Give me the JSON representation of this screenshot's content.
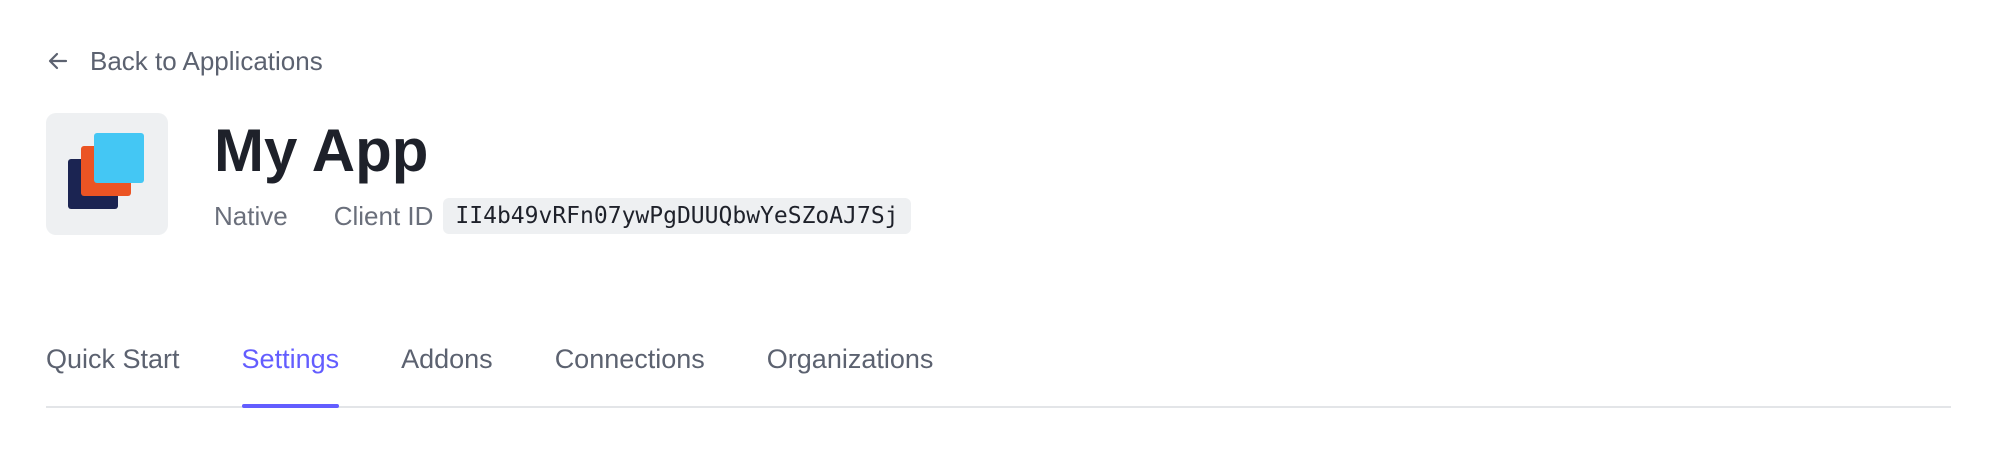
{
  "back_link": {
    "label": "Back to Applications",
    "icon": "arrow-left-icon"
  },
  "app": {
    "name": "My App",
    "type": "Native",
    "client_id_label": "Client ID",
    "client_id": "II4b49vRFn07ywPgDUUQbwYeSZoAJ7Sj",
    "logo_colors": [
      "#1b2452",
      "#eb5424",
      "#44c7f4"
    ]
  },
  "tabs": [
    {
      "label": "Quick Start",
      "active": false
    },
    {
      "label": "Settings",
      "active": true
    },
    {
      "label": "Addons",
      "active": false
    },
    {
      "label": "Connections",
      "active": false
    },
    {
      "label": "Organizations",
      "active": false
    }
  ],
  "colors": {
    "accent": "#635dff",
    "text_primary": "#1e212a",
    "text_secondary": "#5c6270"
  }
}
